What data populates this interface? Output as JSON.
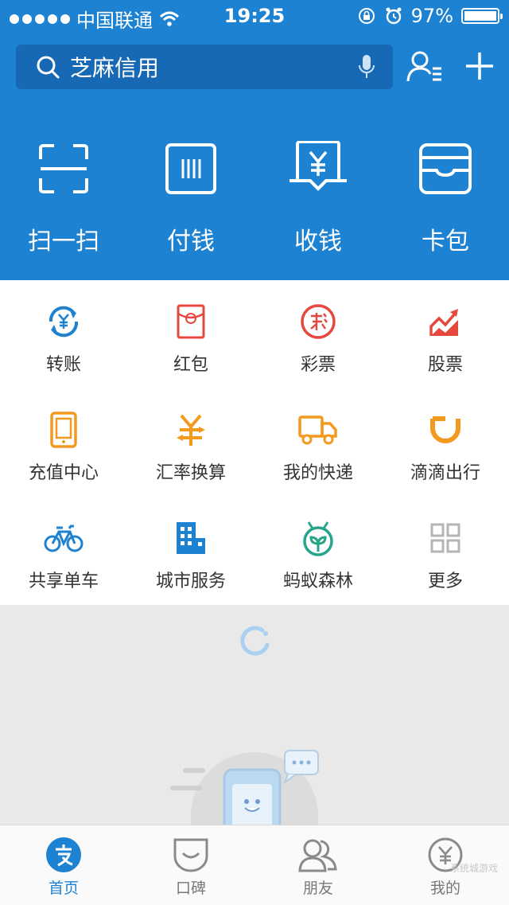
{
  "status_bar": {
    "carrier": "中国联通",
    "time": "19:25",
    "battery": "97%"
  },
  "search": {
    "placeholder": "芝麻信用"
  },
  "main_actions": [
    {
      "label": "扫一扫",
      "icon": "scan-icon"
    },
    {
      "label": "付钱",
      "icon": "barcode-icon"
    },
    {
      "label": "收钱",
      "icon": "receive-money-icon"
    },
    {
      "label": "卡包",
      "icon": "card-wallet-icon"
    }
  ],
  "grid": [
    {
      "label": "转账",
      "icon": "transfer-icon",
      "color": "#1e82d2"
    },
    {
      "label": "红包",
      "icon": "red-envelope-icon",
      "color": "#e5483c"
    },
    {
      "label": "彩票",
      "icon": "lottery-icon",
      "color": "#e5483c"
    },
    {
      "label": "股票",
      "icon": "stock-icon",
      "color": "#e5483c"
    },
    {
      "label": "充值中心",
      "icon": "phone-topup-icon",
      "color": "#f39a1e"
    },
    {
      "label": "汇率换算",
      "icon": "exchange-rate-icon",
      "color": "#f39a1e"
    },
    {
      "label": "我的快递",
      "icon": "delivery-truck-icon",
      "color": "#f39a1e"
    },
    {
      "label": "滴滴出行",
      "icon": "didi-icon",
      "color": "#f39a1e"
    },
    {
      "label": "共享单车",
      "icon": "bicycle-icon",
      "color": "#1e82d2"
    },
    {
      "label": "城市服务",
      "icon": "city-building-icon",
      "color": "#1e82d2"
    },
    {
      "label": "蚂蚁森林",
      "icon": "ant-forest-icon",
      "color": "#27a58a"
    },
    {
      "label": "更多",
      "icon": "more-grid-icon",
      "color": "#b5b5b5"
    }
  ],
  "tabs": [
    {
      "label": "首页",
      "icon": "home-alipay-icon",
      "active": true
    },
    {
      "label": "口碑",
      "icon": "koubei-icon",
      "active": false
    },
    {
      "label": "朋友",
      "icon": "friends-icon",
      "active": false
    },
    {
      "label": "我的",
      "icon": "my-account-icon",
      "active": false
    }
  ],
  "colors": {
    "brand_blue": "#1e82d2",
    "search_bg": "#1869b5",
    "page_bg": "#e9e9e9"
  },
  "watermark": "系统城游戏"
}
